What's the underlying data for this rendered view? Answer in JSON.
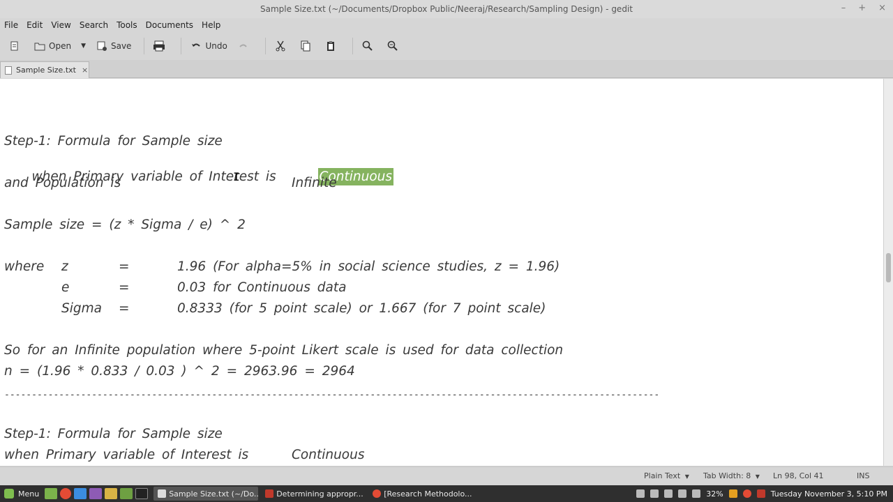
{
  "window": {
    "title": "Sample Size.txt (~/Documents/Dropbox Public/Neeraj/Research/Sampling Design) - gedit",
    "controls": {
      "minimize": "–",
      "maximize": "+",
      "close": "×"
    }
  },
  "menubar": [
    "File",
    "Edit",
    "View",
    "Search",
    "Tools",
    "Documents",
    "Help"
  ],
  "toolbar": {
    "open_label": "Open",
    "save_label": "Save",
    "undo_label": "Undo"
  },
  "tab": {
    "label": "Sample Size.txt",
    "close": "×"
  },
  "document": {
    "block1": {
      "title": "Step-1: Formula for Sample size",
      "var_label": "when Primary variable of Interest is",
      "var_value": "Continuous",
      "pop_label": "and Population is",
      "pop_value": "Infinite",
      "formula": "Sample size = (z * Sigma / e) ^ 2",
      "where": "where",
      "z_name": "z",
      "z_eq": "=",
      "z_value": "1.96 (For alpha=5% in social science studies, z = 1.96)",
      "e_name": "e",
      "e_eq": "=",
      "e_value": "0.03 for Continuous data",
      "sigma_name": "Sigma",
      "sigma_eq": "=",
      "sigma_value": "0.8333 (for 5 point scale) or 1.667 (for 7 point scale)",
      "conclusion": "So for an Infinite population where 5-point Likert scale is used for data collection",
      "calc": "n = (1.96 * 0.833 / 0.03 ) ^ 2 = 2963.96 = 2964"
    },
    "separator": "------------------------------------------------------------------------------------------------------------------------",
    "block2": {
      "title": "Step-1: Formula for Sample size",
      "var_label": "when Primary variable of Interest is",
      "var_value": "Continuous"
    }
  },
  "statusbar": {
    "language": "Plain Text",
    "tab_width": "Tab Width: 8",
    "position": "Ln 98, Col 41",
    "mode": "INS"
  },
  "taskbar": {
    "menu_label": "Menu",
    "tasks": [
      "Sample Size.txt (~/Do...",
      "Determining appropr...",
      "[Research Methodolo..."
    ],
    "battery": "32%",
    "clock": "Tuesday November 3, 5:10 PM"
  },
  "colors": {
    "highlight": "#85b35f",
    "editor_bg": "#ffffff",
    "chrome_bg": "#d6d6d6",
    "taskbar_bg": "#2f2f2f"
  }
}
